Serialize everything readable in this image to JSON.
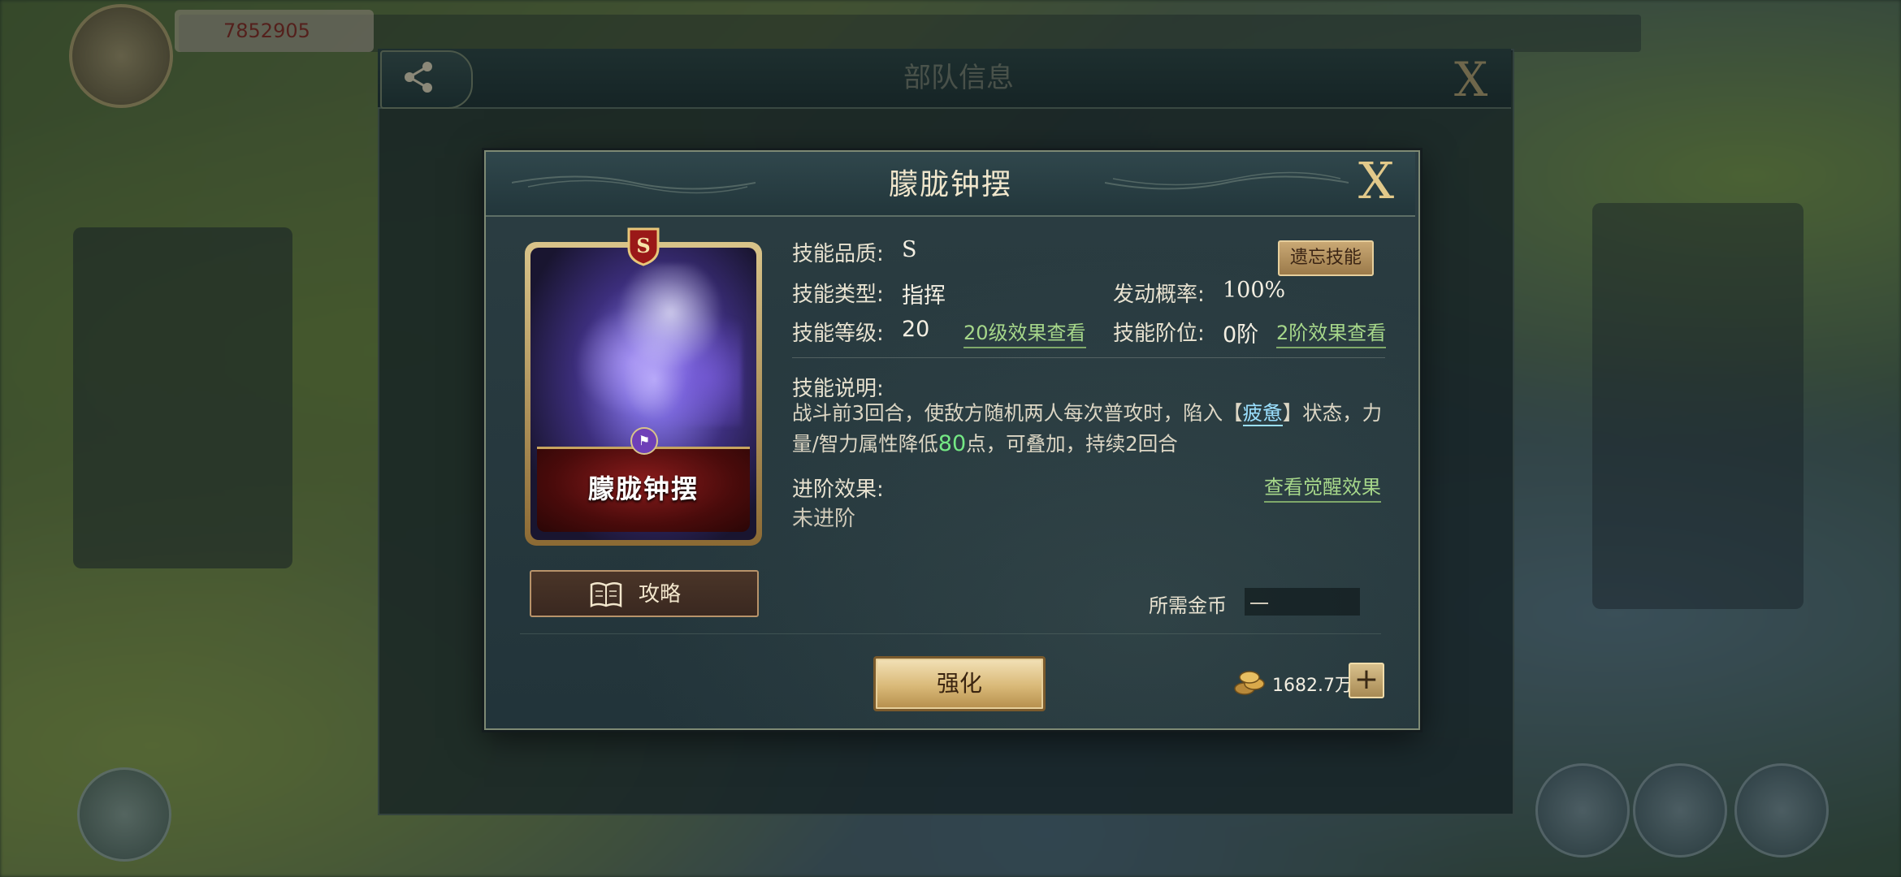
{
  "background": {
    "power_value": "7852905"
  },
  "back_panel": {
    "title": "部队信息",
    "close_symbol": "X"
  },
  "dialog": {
    "title": "朦胧钟摆",
    "close_symbol": "X"
  },
  "card": {
    "grade_letter": "S",
    "name": "朦胧钟摆"
  },
  "guide_button": {
    "label": "攻略"
  },
  "skill": {
    "quality_label": "技能品质:",
    "quality_value": "S",
    "type_label": "技能类型:",
    "type_value": "指挥",
    "trigger_label": "发动概率:",
    "trigger_value": "100%",
    "level_label": "技能等级:",
    "level_value": "20",
    "level_link": "20级效果查看",
    "rank_label": "技能阶位:",
    "rank_value": "0阶",
    "rank_link": "2阶效果查看",
    "desc_label": "技能说明:",
    "desc_part1": "战斗前3回合，使敌方随机两人每次普攻时，陷入【",
    "desc_status": "疲惫",
    "desc_part2": "】状态，力量/智力属性降低",
    "desc_number": "80",
    "desc_part3": "点，可叠加，持续2回合",
    "advance_label": "进阶效果:",
    "advance_value": "未进阶",
    "awaken_link": "查看觉醒效果",
    "forget_button": "遗忘技能"
  },
  "cost": {
    "label": "所需金币",
    "value": "一"
  },
  "footer": {
    "strengthen_button": "强化",
    "gold_amount": "1682.7万",
    "plus_symbol": "+"
  },
  "colors": {
    "accent_gold": "#d9b978",
    "link_green": "#a6d78a",
    "status_blue": "#9be0ff",
    "number_green": "#74e884"
  }
}
